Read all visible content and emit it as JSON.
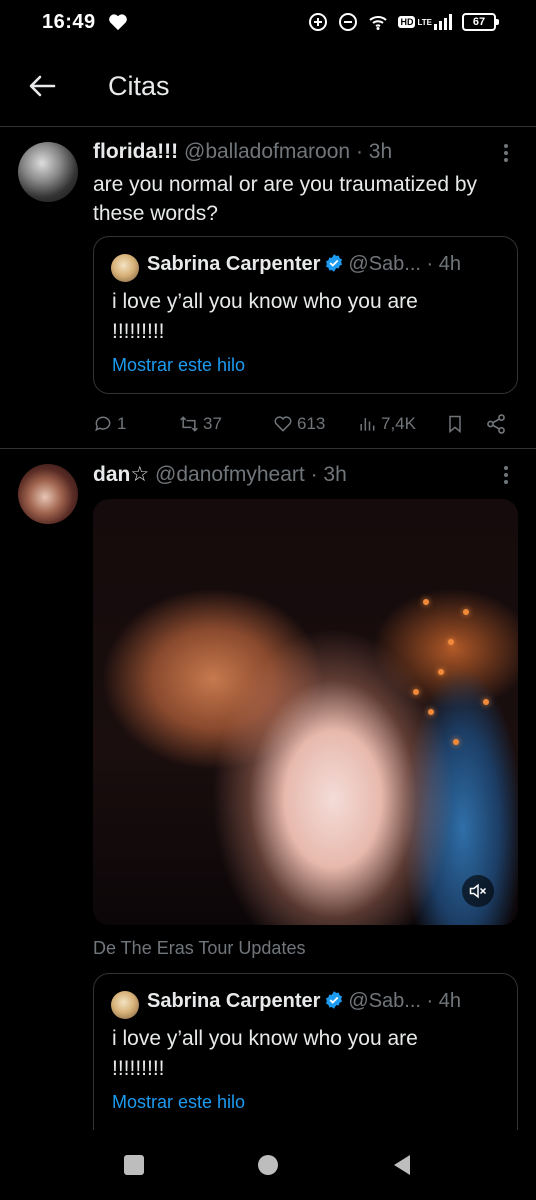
{
  "status_bar": {
    "time": "16:49",
    "network_badge": "HD",
    "network_type": "LTE",
    "battery": "67"
  },
  "header": {
    "title": "Citas"
  },
  "tweets": [
    {
      "name": "florida!!!",
      "handle": "@balladofmaroon",
      "time": "· 3h",
      "text": "are you normal or are you traumatized by these words?",
      "quote": {
        "name": "Sabrina Carpenter",
        "handle": "@Sab...",
        "time": "· 4h",
        "text": "i love y’all you know who you are !!!!!!!!!",
        "link": "Mostrar este hilo"
      },
      "actions": {
        "replies": "1",
        "reposts": "37",
        "likes": "613",
        "views": "7,4K"
      }
    },
    {
      "name": "dan☆",
      "handle": "@danofmyheart",
      "time": "· 3h",
      "media_source": "De The Eras Tour Updates",
      "quote": {
        "name": "Sabrina Carpenter",
        "handle": "@Sab...",
        "time": "· 4h",
        "text": "i love y’all you know who you are !!!!!!!!!",
        "link": "Mostrar este hilo"
      }
    }
  ],
  "colors": {
    "background": "#000000",
    "text": "#e7e9ea",
    "secondary": "#71767b",
    "accent": "#1d9bf0",
    "border": "#2f3336"
  }
}
